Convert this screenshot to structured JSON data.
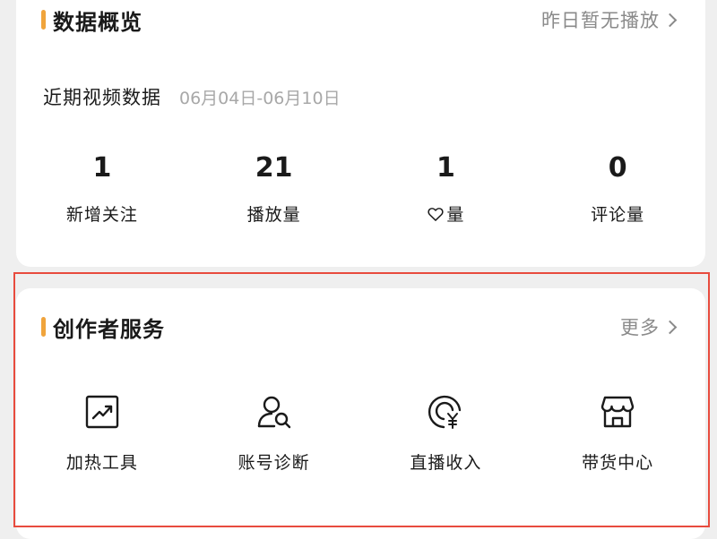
{
  "data_overview": {
    "title": "数据概览",
    "link": "昨日暂无播放",
    "subhead_title": "近期视频数据",
    "date_range": "06月04日-06月10日",
    "stats": [
      {
        "value": "1",
        "label": "新增关注"
      },
      {
        "value": "21",
        "label": "播放量"
      },
      {
        "value": "1",
        "label": "量",
        "label_icon": "heart-icon"
      },
      {
        "value": "0",
        "label": "评论量"
      }
    ]
  },
  "creator_services": {
    "title": "创作者服务",
    "link": "更多",
    "items": [
      {
        "label": "加热工具",
        "icon": "trend-chart-icon"
      },
      {
        "label": "账号诊断",
        "icon": "user-search-icon"
      },
      {
        "label": "直播收入",
        "icon": "yen-income-icon"
      },
      {
        "label": "带货中心",
        "icon": "storefront-icon"
      }
    ]
  },
  "colors": {
    "accent": "#f0a43c",
    "highlight_frame": "#e84b3e",
    "muted_text": "#8a8a8a",
    "background": "#efefef"
  }
}
